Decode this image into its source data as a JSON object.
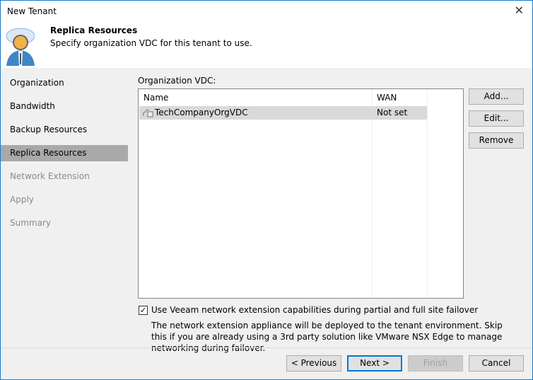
{
  "window": {
    "title": "New Tenant",
    "close": "✕"
  },
  "header": {
    "title": "Replica Resources",
    "subtitle": "Specify organization VDC for this tenant to use."
  },
  "sidebar": {
    "items": [
      {
        "label": "Organization",
        "state": "normal"
      },
      {
        "label": "Bandwidth",
        "state": "normal"
      },
      {
        "label": "Backup Resources",
        "state": "normal"
      },
      {
        "label": "Replica Resources",
        "state": "active"
      },
      {
        "label": "Network Extension",
        "state": "disabled"
      },
      {
        "label": "Apply",
        "state": "disabled"
      },
      {
        "label": "Summary",
        "state": "disabled"
      }
    ]
  },
  "main": {
    "list_label": "Organization VDC:",
    "columns": [
      "Name",
      "WAN"
    ],
    "rows": [
      {
        "name": "TechCompanyOrgVDC",
        "wan": "Not set",
        "icon": "org-vdc-icon"
      }
    ],
    "add": "Add...",
    "edit": "Edit...",
    "remove": "Remove",
    "checkbox_label": "Use Veeam network extension capabilities during partial and full site failover",
    "checkbox_checked": true,
    "description": "The network extension appliance will be deployed to the tenant environment. Skip this if you are already using a 3rd party solution like VMware NSX Edge to manage networking during failover."
  },
  "footer": {
    "previous": "< Previous",
    "next": "Next >",
    "finish": "Finish",
    "cancel": "Cancel"
  }
}
